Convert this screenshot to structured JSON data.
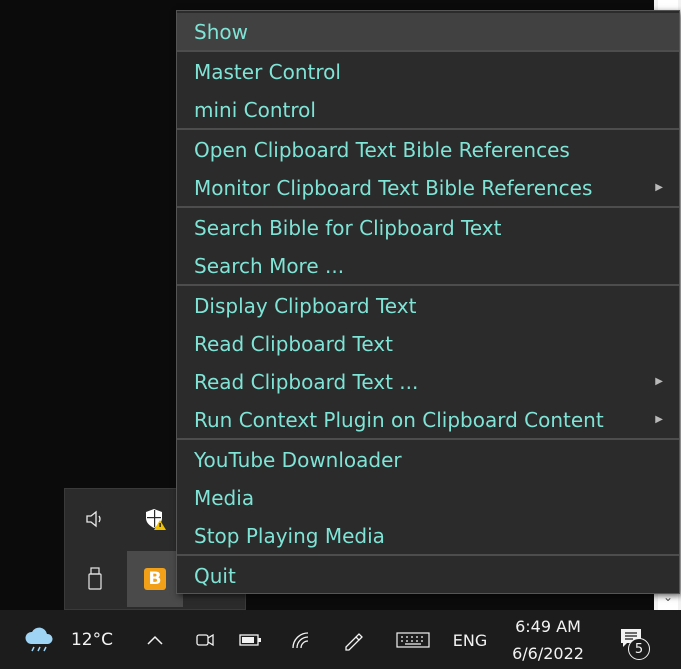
{
  "context_menu": {
    "items": [
      {
        "label": "Show",
        "submenu": false
      },
      {
        "label": "Master Control",
        "submenu": false
      },
      {
        "label": "mini Control",
        "submenu": false
      },
      {
        "label": "Open Clipboard Text Bible References",
        "submenu": false
      },
      {
        "label": "Monitor Clipboard Text Bible References",
        "submenu": true
      },
      {
        "label": "Search Bible for Clipboard Text",
        "submenu": false
      },
      {
        "label": "Search More ...",
        "submenu": false
      },
      {
        "label": "Display Clipboard Text",
        "submenu": false
      },
      {
        "label": "Read Clipboard Text",
        "submenu": false
      },
      {
        "label": "Read Clipboard Text ...",
        "submenu": true
      },
      {
        "label": "Run Context Plugin on Clipboard Content",
        "submenu": true
      },
      {
        "label": "YouTube Downloader",
        "submenu": false
      },
      {
        "label": "Media",
        "submenu": false
      },
      {
        "label": "Stop Playing Media",
        "submenu": false
      },
      {
        "label": "Quit",
        "submenu": false
      }
    ],
    "text_color": "#7fe4d6",
    "background": "#2b2b2b"
  },
  "tray_flyout": {
    "icons": [
      "volume-icon",
      "windows-security-warning-icon",
      "usb-drive-icon",
      "bible-app-b-icon"
    ],
    "app_letter": "B"
  },
  "taskbar": {
    "weather": {
      "temperature": "12°C",
      "icon": "cloud-rain-icon"
    },
    "language": "ENG",
    "time": "6:49 AM",
    "date": "6/6/2022",
    "notification_count": "5"
  }
}
